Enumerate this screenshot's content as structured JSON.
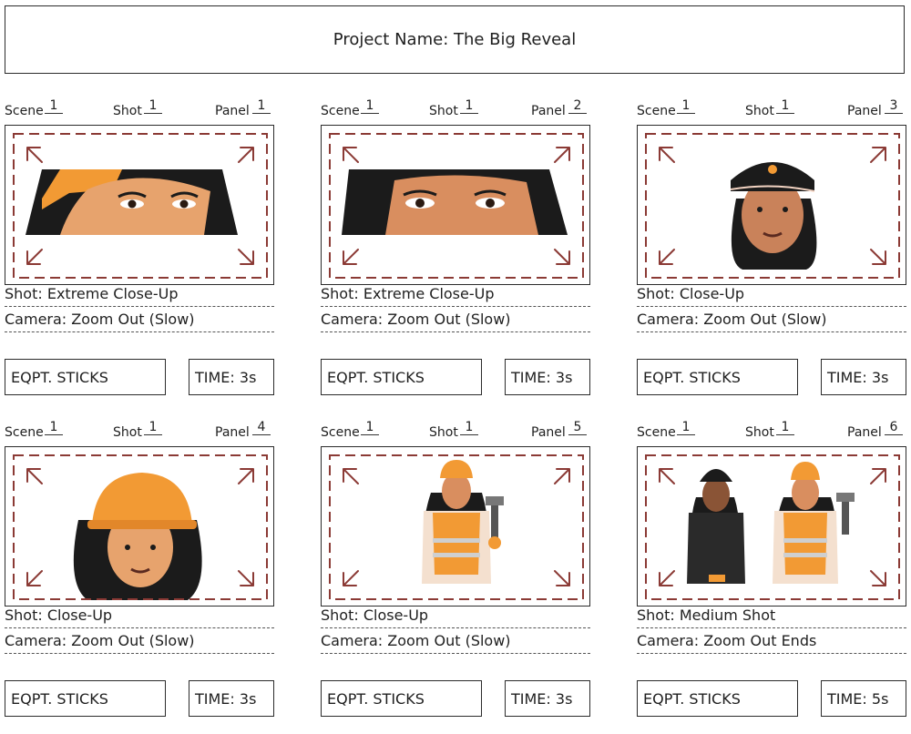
{
  "project": {
    "title": "Project Name: The Big Reveal"
  },
  "labels": {
    "scene": "Scene",
    "shot": "Shot",
    "panel": "Panel"
  },
  "colors": {
    "frame_guide": "#8B3A35",
    "accent_orange": "#F29A34",
    "skin": "#D98E5F",
    "hair": "#1B1B1B"
  },
  "panels": [
    {
      "scene": "1",
      "shot": "1",
      "panel": "1",
      "shot_type": "Shot: Extreme Close-Up",
      "camera": "Camera: Zoom Out (Slow)",
      "eqpt": "EQPT. STICKS",
      "time": "TIME: 3s",
      "image": "worker-eyes-closeup"
    },
    {
      "scene": "1",
      "shot": "1",
      "panel": "2",
      "shot_type": "Shot: Extreme Close-Up",
      "camera": "Camera: Zoom Out (Slow)",
      "eqpt": "EQPT. STICKS",
      "time": "TIME: 3s",
      "image": "officer-eyes-closeup"
    },
    {
      "scene": "1",
      "shot": "1",
      "panel": "3",
      "shot_type": "Shot: Close-Up",
      "camera": "Camera: Zoom Out (Slow)",
      "eqpt": "EQPT. STICKS",
      "time": "TIME: 3s",
      "image": "police-officer-face"
    },
    {
      "scene": "1",
      "shot": "1",
      "panel": "4",
      "shot_type": "Shot: Close-Up",
      "camera": "Camera: Zoom Out (Slow)",
      "eqpt": "EQPT. STICKS",
      "time": "TIME: 3s",
      "image": "construction-worker-face"
    },
    {
      "scene": "1",
      "shot": "1",
      "panel": "5",
      "shot_type": "Shot: Close-Up",
      "camera": "Camera: Zoom Out (Slow)",
      "eqpt": "EQPT. STICKS",
      "time": "TIME: 3s",
      "image": "construction-worker-body"
    },
    {
      "scene": "1",
      "shot": "1",
      "panel": "6",
      "shot_type": "Shot: Medium Shot",
      "camera": "Camera: Zoom Out Ends",
      "eqpt": "EQPT. STICKS",
      "time": "TIME: 5s",
      "image": "officer-and-worker"
    }
  ]
}
